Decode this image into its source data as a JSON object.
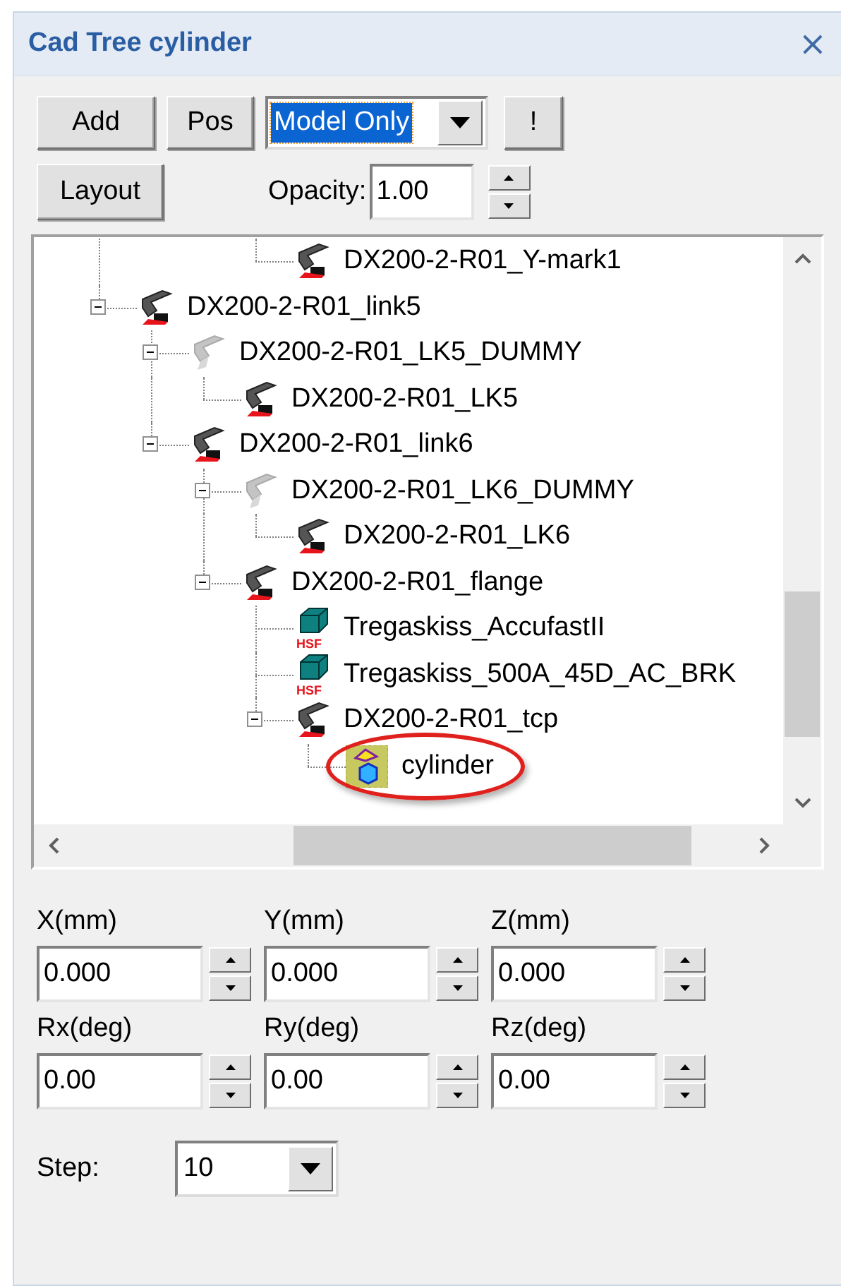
{
  "window": {
    "title": "Cad Tree cylinder",
    "close": "×"
  },
  "toolbar": {
    "buttons": [
      "Add",
      "Pos"
    ],
    "mode_dropdown": {
      "value": "Model Only",
      "selected": true
    },
    "exclamation_button": "!",
    "layout_button": "Layout",
    "opacity": {
      "label": "Opacity:",
      "value": "1.00"
    }
  },
  "tree": {
    "nodes": [
      {
        "children": [
          {
            "children": [
              {
                "children": [
                  {
                    "label": "DX200-2-R01_Y-mark1",
                    "kind": "robot"
                  }
                ]
              }
            ]
          }
        ]
      },
      {
        "label": "DX200-2-R01_link5",
        "kind": "robot",
        "expanded": true,
        "children": [
          {
            "label": "DX200-2-R01_LK5_DUMMY",
            "kind": "dummy",
            "expanded": true,
            "children": [
              {
                "label": "DX200-2-R01_LK5",
                "kind": "robot"
              }
            ]
          },
          {
            "label": "DX200-2-R01_link6",
            "kind": "robot",
            "expanded": true,
            "children": [
              {
                "label": "DX200-2-R01_LK6_DUMMY",
                "kind": "dummy",
                "expanded": true,
                "children": [
                  {
                    "label": "DX200-2-R01_LK6",
                    "kind": "robot"
                  }
                ]
              },
              {
                "label": "DX200-2-R01_flange",
                "kind": "robot",
                "expanded": true,
                "children": [
                  {
                    "label": "Tregaskiss_AccufastII",
                    "kind": "part",
                    "badge": "HSF"
                  },
                  {
                    "label": "Tregaskiss_500A_45D_AC_BRK",
                    "kind": "part",
                    "badge": "HSF"
                  },
                  {
                    "label": "DX200-2-R01_tcp",
                    "kind": "robot",
                    "expanded": true,
                    "children": [
                      {
                        "label": "cylinder",
                        "kind": "tool",
                        "highlighted": true
                      }
                    ]
                  }
                ]
              }
            ]
          }
        ]
      }
    ]
  },
  "fields": [
    {
      "label": "X(mm)",
      "value": "0.000"
    },
    {
      "label": "Y(mm)",
      "value": "0.000"
    },
    {
      "label": "Z(mm)",
      "value": "0.000"
    },
    {
      "label": "Rx(deg)",
      "value": "0.00"
    },
    {
      "label": "Ry(deg)",
      "value": "0.00"
    },
    {
      "label": "Rz(deg)",
      "value": "0.00"
    }
  ],
  "step": {
    "label": "Step:",
    "value": "10"
  }
}
